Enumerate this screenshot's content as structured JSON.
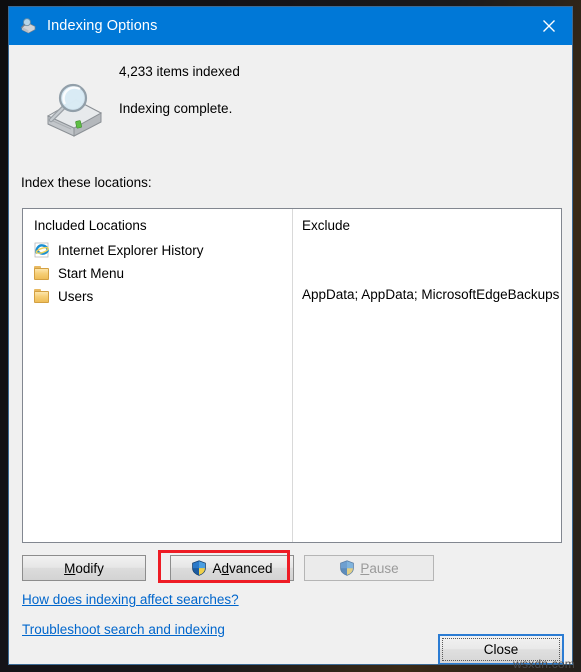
{
  "window": {
    "title": "Indexing Options",
    "title_icon": "indexing-search-drive-icon",
    "close_icon": "close-x-icon",
    "accent_color": "#0078d7"
  },
  "status": {
    "icon": "drive-with-magnifier-icon",
    "items_indexed": "4,233 items indexed",
    "state": "Indexing complete."
  },
  "locations": {
    "label": "Index these locations:",
    "columns": {
      "included": "Included Locations",
      "exclude": "Exclude"
    },
    "rows": [
      {
        "icon": "internet-explorer-icon",
        "label": "Internet Explorer History",
        "exclude": ""
      },
      {
        "icon": "folder-icon",
        "label": "Start Menu",
        "exclude": ""
      },
      {
        "icon": "folder-icon",
        "label": "Users",
        "exclude": "AppData; AppData; MicrosoftEdgeBackups"
      }
    ]
  },
  "buttons": {
    "modify": {
      "label_prefix": "",
      "accel": "M",
      "label_rest": "odify",
      "enabled": true
    },
    "advanced": {
      "label_prefix": "A",
      "accel": "d",
      "label_rest": "vanced",
      "enabled": true,
      "icon": "uac-shield-icon",
      "highlight_color": "#ee1c25"
    },
    "pause": {
      "label_prefix": "",
      "accel": "P",
      "label_rest": "ause",
      "enabled": false,
      "icon": "uac-shield-icon"
    },
    "close": {
      "label": "Close",
      "focused": true
    }
  },
  "links": {
    "how_does_indexing": "How does indexing affect searches?",
    "troubleshoot": "Troubleshoot search and indexing"
  },
  "watermark": "wsxdn.com"
}
